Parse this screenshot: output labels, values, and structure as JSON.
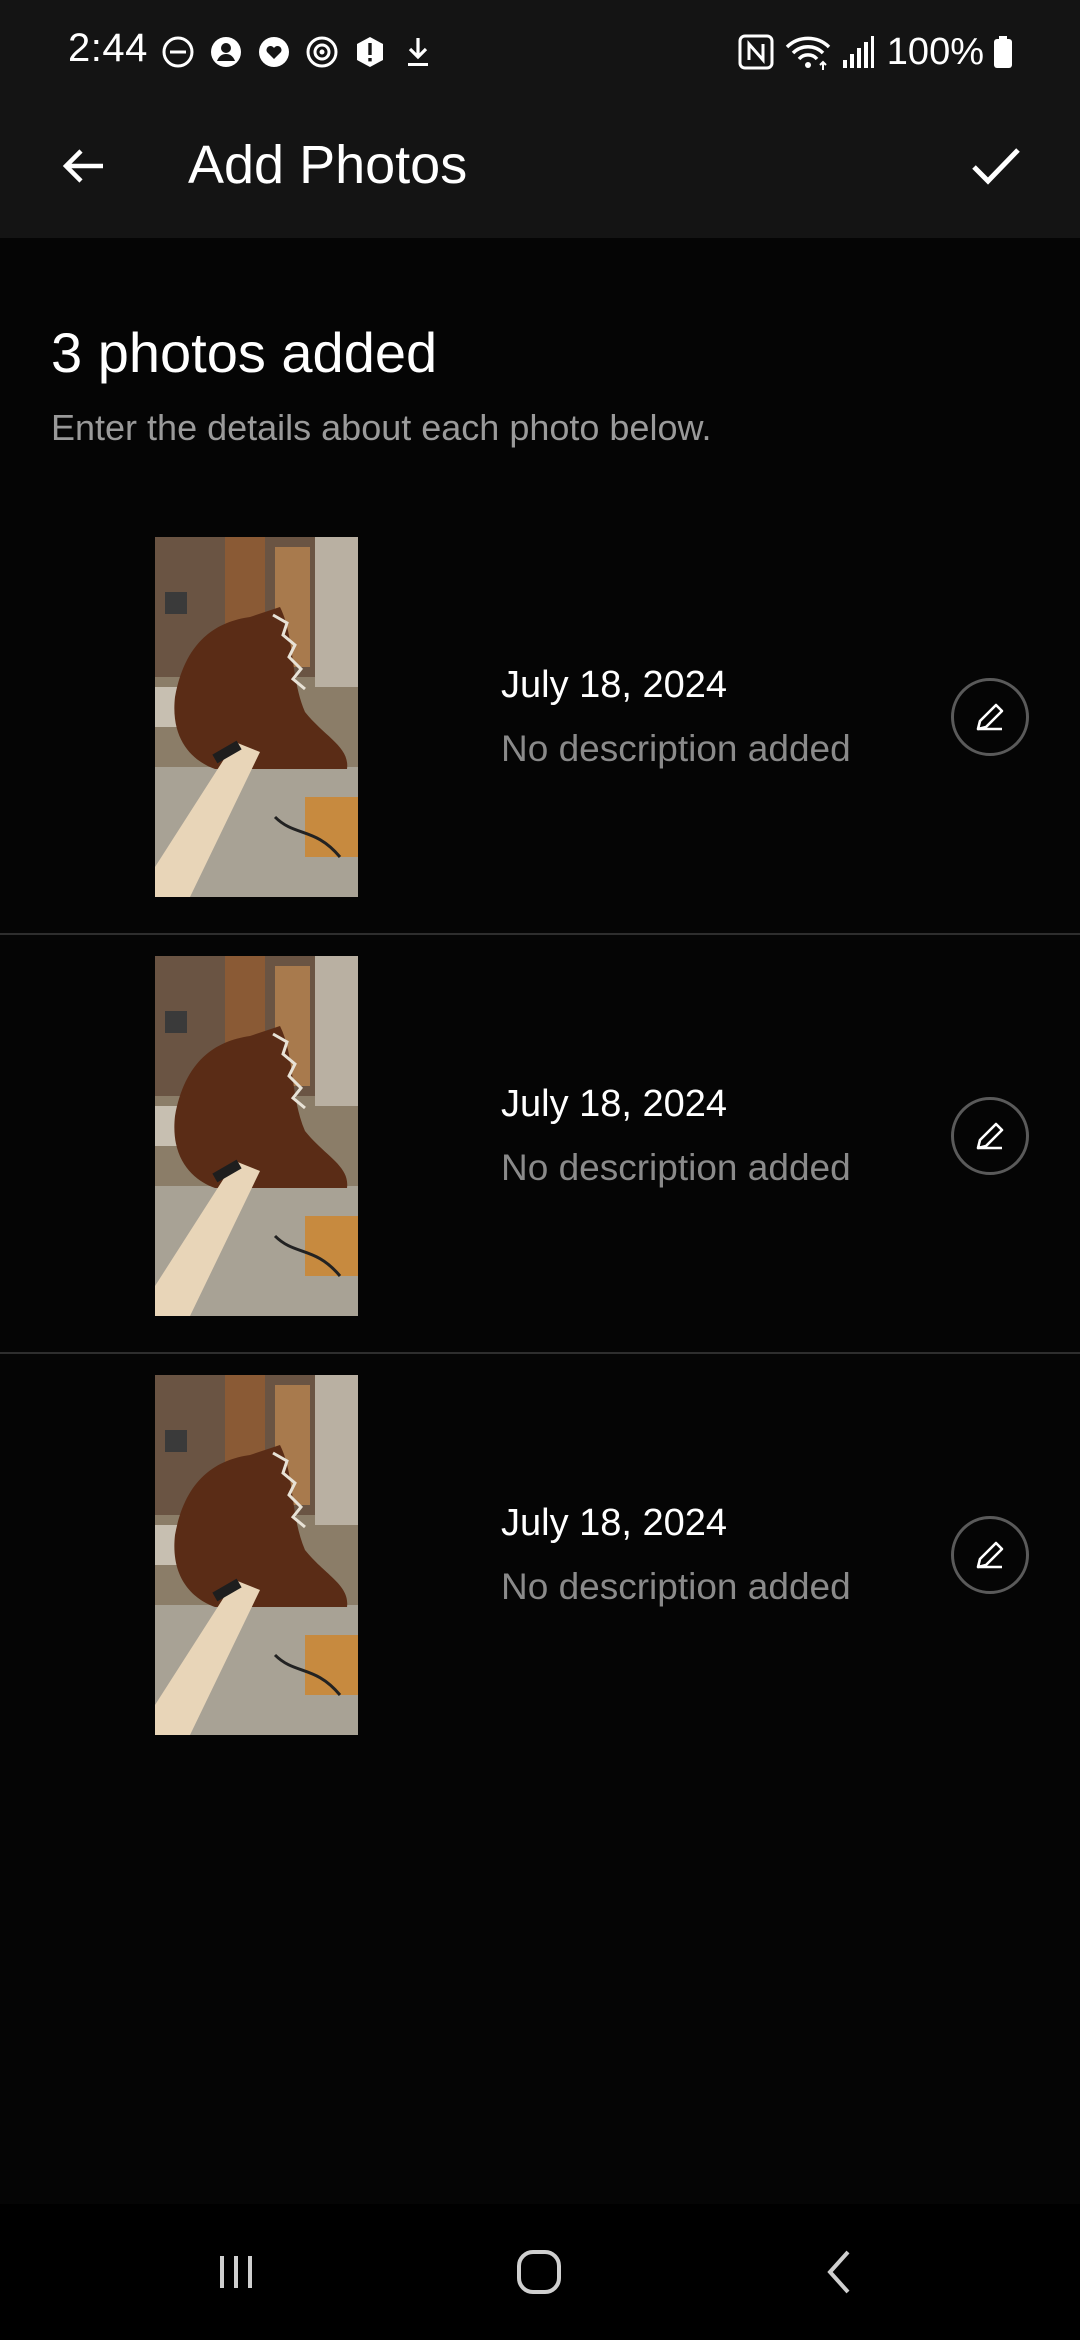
{
  "status_bar": {
    "time": "2:44",
    "battery_percent": "100%",
    "left_icons": [
      "do-not-disturb-icon",
      "account-icon",
      "heart-app-icon",
      "sync-app-icon",
      "alert-icon",
      "download-icon"
    ],
    "right_icons": [
      "nfc-icon",
      "wifi-icon",
      "signal-icon",
      "battery-icon"
    ]
  },
  "app_bar": {
    "title": "Add Photos",
    "back_icon": "arrow-left-icon",
    "confirm_icon": "check-icon"
  },
  "header": {
    "count_text": "3 photos added",
    "instruction": "Enter the details about each photo below."
  },
  "photos": [
    {
      "date": "July 18, 2024",
      "description": "No description added",
      "edit_icon": "pencil-icon"
    },
    {
      "date": "July 18, 2024",
      "description": "No description added",
      "edit_icon": "pencil-icon"
    },
    {
      "date": "July 18, 2024",
      "description": "No description added",
      "edit_icon": "pencil-icon"
    }
  ],
  "nav_bar": {
    "icons": [
      "recents-icon",
      "home-icon",
      "back-chevron-icon"
    ]
  },
  "colors": {
    "background": "#050505",
    "bar_background": "#141414",
    "secondary_text": "#8a8a8a",
    "divider": "#2e2e2e"
  }
}
